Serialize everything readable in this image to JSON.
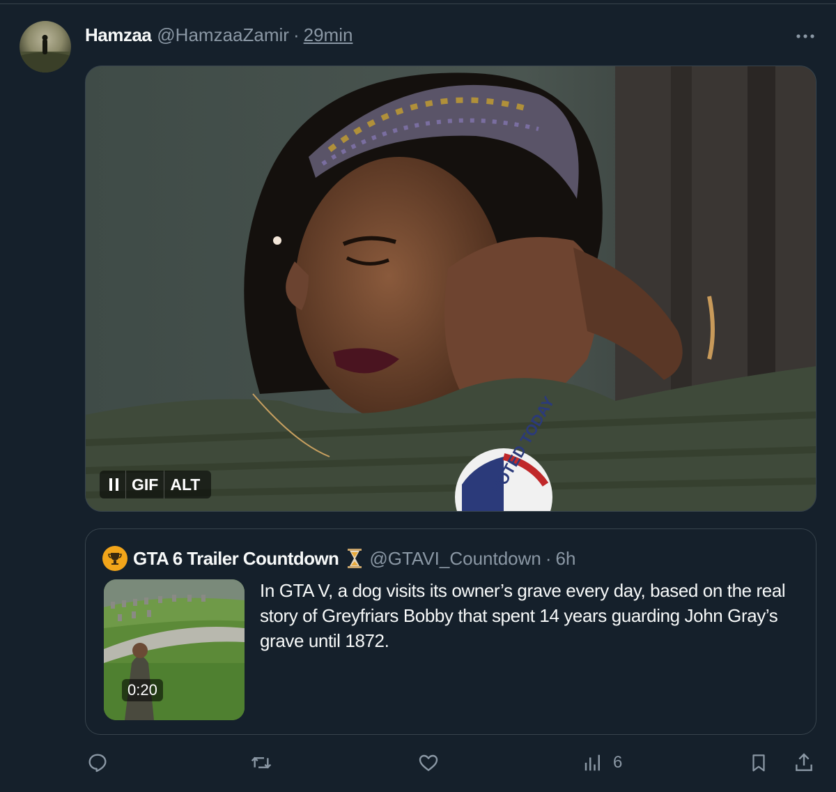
{
  "tweet": {
    "author_name": "Hamzaa",
    "author_handle": "@HamzaaZamir",
    "separator": "·",
    "time": "29min",
    "more_icon": "more-icon",
    "media": {
      "type": "GIF",
      "pause_label": "II",
      "gif_label": "GIF",
      "alt_label": "ALT",
      "badge_text": "VOTED TODAY"
    }
  },
  "quote": {
    "author_name": "GTA 6 Trailer Countdown",
    "author_handle": "@GTAVI_Countdown",
    "separator": "·",
    "time": "6h",
    "text": "In GTA V, a dog visits its owner’s grave every day, based on the real story of Greyfriars Bobby that spent 14 years guarding John Gray’s grave until 1872.",
    "video_duration": "0:20"
  },
  "actions": {
    "reply_icon": "reply-icon",
    "retweet_icon": "retweet-icon",
    "like_icon": "like-icon",
    "views_icon": "views-icon",
    "views_count": "6",
    "bookmark_icon": "bookmark-icon",
    "share_icon": "share-icon"
  },
  "colors": {
    "background": "#15202b",
    "border": "#38444d",
    "secondary_text": "#8b98a5",
    "primary_text": "#f7f9f9"
  }
}
